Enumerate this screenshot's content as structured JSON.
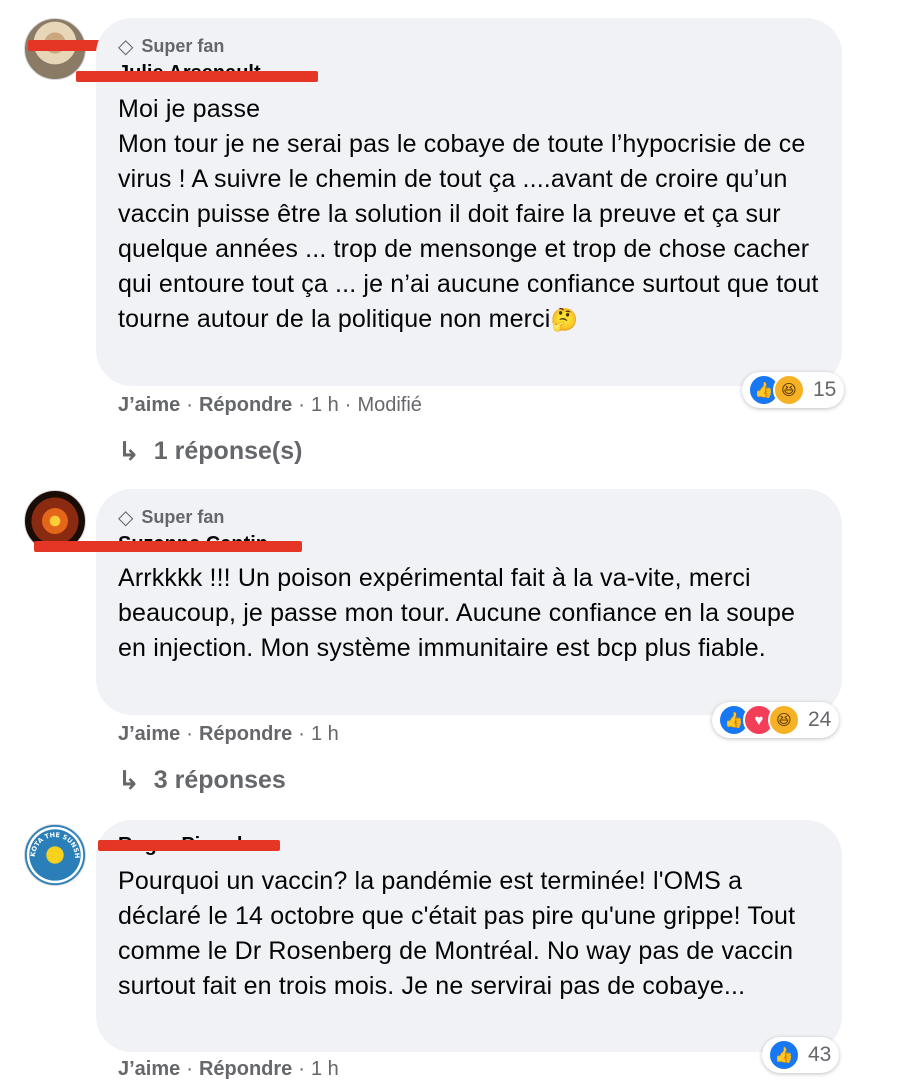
{
  "comments": [
    {
      "badge": "Super fan",
      "badge_icon": "diamond-icon",
      "author": "Julie Arsenault",
      "text": "Moi je passe\nMon tour je ne serai pas le cobaye de toute l’hypocrisie de ce virus ! A suivre le chemin de tout ça ....avant de croire qu’un vaccin puisse être la solution il doit faire la preuve et ça sur quelque années ... trop de mensonge et trop de chose cacher qui entoure tout ça ... je n’ai aucune confiance surtout que tout tourne autour de la politique non merci",
      "text_emoji": "🤔",
      "reactions": [
        "like",
        "haha"
      ],
      "reaction_count": "15",
      "like": "J’aime",
      "reply": "Répondre",
      "time": "1 h",
      "edited": "Modifié",
      "replies_label": "1 réponse(s)"
    },
    {
      "badge": "Super fan",
      "badge_icon": "diamond-icon",
      "author": "Suzanne Cantin",
      "text": "Arrkkkk !!! Un poison expérimental fait à la va-vite, merci beaucoup, je passe mon tour. Aucune confiance en la soupe en injection. Mon système immunitaire est bcp plus fiable.",
      "reactions": [
        "like",
        "love",
        "haha"
      ],
      "reaction_count": "24",
      "like": "J’aime",
      "reply": "Répondre",
      "time": "1 h",
      "replies_label": "3 réponses"
    },
    {
      "author": "Roger Picard",
      "avatar_text": "SOUTH DAKOTA THE SUNSHINE STATE",
      "text": "Pourquoi un vaccin? la pandémie est terminée! l'OMS a déclaré le 14 octobre que c'était pas pire qu'une grippe! Tout comme le Dr Rosenberg de Montréal. No way pas de vaccin surtout fait en trois mois. Je ne servirai pas de cobaye...",
      "reactions": [
        "like"
      ],
      "reaction_count": "43",
      "like": "J’aime",
      "reply": "Répondre",
      "time": "1 h"
    }
  ],
  "colors": {
    "like": "#1877f2",
    "love": "#f33e58",
    "haha": "#f7b125",
    "bubble": "#f0f2f5",
    "redaction": "#e53525"
  }
}
